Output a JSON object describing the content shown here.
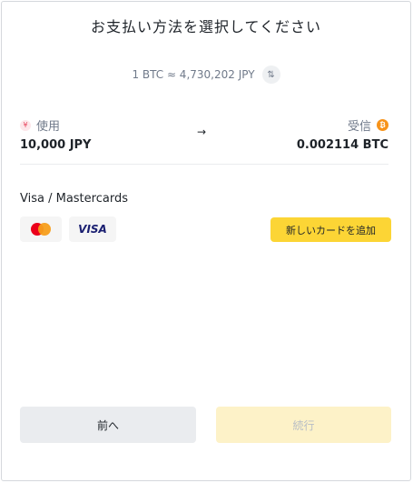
{
  "header": {
    "title": "お支払い方法を選択してください"
  },
  "rate": {
    "text": "1 BTC ≈ 4,730,202 JPY",
    "swap_icon": "swap-vertical-icon"
  },
  "pay": {
    "label": "使用",
    "amount": "10,000 JPY",
    "icon": "yen-icon"
  },
  "receive": {
    "label": "受信",
    "amount": "0.002114 BTC",
    "icon": "bitcoin-icon"
  },
  "arrow": "→",
  "payment_methods": {
    "section_title": "Visa / Mastercards",
    "logos": [
      "mastercard-logo",
      "visa-logo"
    ],
    "visa_text": "VISA",
    "add_card_label": "新しいカードを追加"
  },
  "footer": {
    "back_label": "前へ",
    "continue_label": "続行",
    "continue_enabled": false
  },
  "colors": {
    "accent": "#fcd535",
    "accent_disabled": "#fdf2c8",
    "btc": "#f7931a"
  }
}
